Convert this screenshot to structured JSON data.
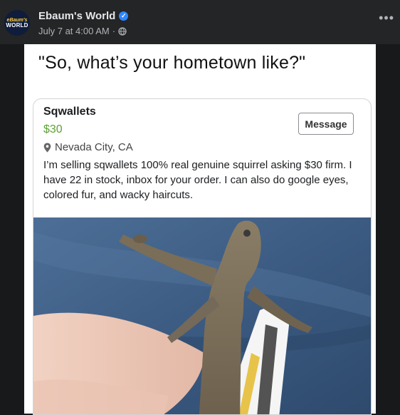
{
  "post": {
    "page_name": "Ebaum's World",
    "avatar_text_top": "eBaum's",
    "avatar_text_bottom": "WORLD",
    "timestamp": "July 7 at 4:00 AM",
    "separator": "·",
    "more_label": "•••",
    "caption": "\"So, what’s your hometown like?\""
  },
  "listing": {
    "title": "Sqwallets",
    "price": "$30",
    "location": "Nevada City, CA",
    "description": "I’m selling sqwallets 100% real genuine squirrel asking $30 firm. I have 22 in stock, inbox for your order. I can also do google eyes, colored fur, and wacky haircuts.",
    "message_label": "Message"
  },
  "colors": {
    "header_bg": "#242526",
    "price_green": "#5aa233",
    "verified_blue": "#2d88ff",
    "jeans_blue": "#3f5f86"
  }
}
